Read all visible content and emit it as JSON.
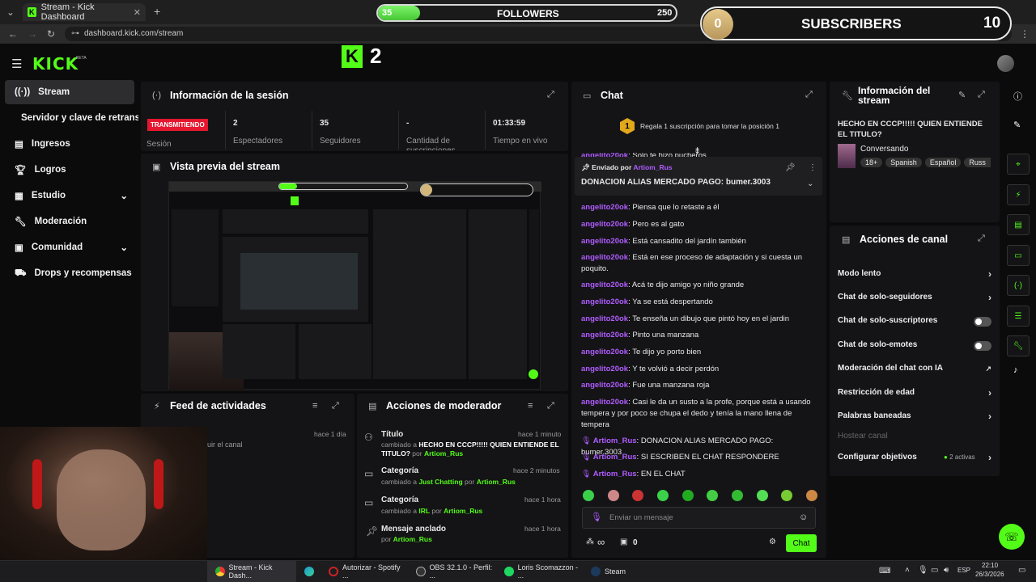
{
  "browser": {
    "tab_title": "Stream - Kick Dashboard",
    "url": "dashboard.kick.com/stream"
  },
  "overlay": {
    "followers_current": "35",
    "followers_label": "FOLLOWERS",
    "followers_goal": "250",
    "followers_progress": 0.14,
    "subscribers_current": "0",
    "subscribers_label": "SUBSCRIBERS",
    "subscribers_goal": "10",
    "kick_badge": "2"
  },
  "brand": {
    "logo": "KICK",
    "beta": "BETA",
    "accent": "#53fc18"
  },
  "sidebar": {
    "items": [
      {
        "label": "Stream",
        "icon": "broadcast-icon"
      },
      {
        "label": "Servidor y clave de retransmisión"
      },
      {
        "label": "Ingresos",
        "icon": "dollar-icon"
      },
      {
        "label": "Logros",
        "icon": "trophy-icon"
      },
      {
        "label": "Estudio",
        "icon": "studio-icon"
      },
      {
        "label": "Moderación",
        "icon": "wrench-icon"
      },
      {
        "label": "Comunidad",
        "icon": "community-icon"
      },
      {
        "label": "Drops y recompensas",
        "icon": "drops-icon"
      }
    ]
  },
  "session": {
    "title": "Información de la sesión",
    "status": "TRANSMITIENDO",
    "status_label": "Sesión",
    "stats": [
      {
        "value": "2",
        "label": "Espectadores"
      },
      {
        "value": "35",
        "label": "Seguidores"
      },
      {
        "value": "-",
        "label": "Cantidad de suscripciones"
      },
      {
        "value": "01:33:59",
        "label": "Tiempo en vivo"
      }
    ]
  },
  "preview": {
    "title": "Vista previa del stream"
  },
  "feed": {
    "title": "Feed de actividades",
    "item_time": "hace 1 día",
    "item_text": "uir el canal"
  },
  "modactions": {
    "title": "Acciones de moderador",
    "items": [
      {
        "title": "Título",
        "time": "hace 1 minuto",
        "prefix": "cambiado a",
        "value": "HECHO EN CCCP!!!!! QUIEN ENTIENDE EL TITULO?",
        "by": "por",
        "user": "Artiom_Rus"
      },
      {
        "title": "Categoría",
        "time": "hace 2 minutos",
        "prefix": "cambiado a",
        "value": "Just Chatting",
        "by": "por",
        "user": "Artiom_Rus"
      },
      {
        "title": "Categoría",
        "time": "hace 1 hora",
        "prefix": "cambiado a",
        "value": "IRL",
        "by": "por",
        "user": "Artiom_Rus"
      },
      {
        "title": "Mensaje anclado",
        "time": "hace 1 hora",
        "prefix": "",
        "value": "",
        "by": "por",
        "user": "Artiom_Rus"
      }
    ]
  },
  "chat": {
    "title": "Chat",
    "gift_rank": "1",
    "gift_text": "Regala 1 suscripción para tomar la posición 1",
    "partial_msg_user": "angelito20ok",
    "partial_msg_text": "Solo te hizo pucheros",
    "pinned_label": "Enviado por",
    "pinned_user": "Artiom_Rus",
    "pinned_text": "DONACION ALIAS MERCADO PAGO: bumer.3003",
    "messages": [
      {
        "user": "angelito20ok",
        "text": "Piensa que lo retaste a él"
      },
      {
        "user": "angelito20ok",
        "text": "Pero es al gato"
      },
      {
        "user": "angelito20ok",
        "text": "Está cansadito del jardín también"
      },
      {
        "user": "angelito20ok",
        "text": "Está en ese proceso de adaptación y si cuesta un poquito."
      },
      {
        "user": "angelito20ok",
        "text": "Acá te dijo amigo yo niño grande"
      },
      {
        "user": "angelito20ok",
        "text": "Ya se está despertando"
      },
      {
        "user": "angelito20ok",
        "text": "Te enseña un dibujo que pintó hoy en el jardin"
      },
      {
        "user": "angelito20ok",
        "text": "Pinto una manzana"
      },
      {
        "user": "angelito20ok",
        "text": "Te dijo yo porto bien"
      },
      {
        "user": "angelito20ok",
        "text": "Y te volvió a decir perdón"
      },
      {
        "user": "angelito20ok",
        "text": "Fue una manzana roja"
      },
      {
        "user": "angelito20ok",
        "text": "Casi le da un susto a la profe, porque está a usando tempera y por poco se chupa el dedo y tenía la mano llena de tempera"
      },
      {
        "user": "Artiom_Rus",
        "text": "DONACION ALIAS MERCADO PAGO: bumer.3003"
      },
      {
        "user": "Artiom_Rus",
        "text": "SI ESCRIBEN EL CHAT RESPONDERE"
      },
      {
        "user": "Artiom_Rus",
        "text": "EN EL CHAT"
      }
    ],
    "input_placeholder": "Enviar un mensaje",
    "infinity": "∞",
    "points": "0",
    "send_label": "Chat"
  },
  "streaminfo": {
    "title": "Información del stream",
    "stream_title": "HECHO EN CCCP!!!!! QUIEN ENTIENDE EL TITULO?",
    "category": "Conversando",
    "tags": [
      "18+",
      "Spanish",
      "Español",
      "Russ"
    ]
  },
  "channel_actions": {
    "title": "Acciones de canal",
    "items": [
      {
        "label": "Modo lento",
        "control": "chevron"
      },
      {
        "label": "Chat de solo-seguidores",
        "control": "chevron"
      },
      {
        "label": "Chat de solo-suscriptores",
        "control": "toggle"
      },
      {
        "label": "Chat de solo-emotes",
        "control": "toggle"
      },
      {
        "label": "Moderación del chat con IA",
        "control": "external"
      },
      {
        "label": "Restricción de edad",
        "control": "chevron"
      },
      {
        "label": "Palabras baneadas",
        "control": "chevron"
      },
      {
        "label": "Hostear canal",
        "control": "none"
      },
      {
        "label": "Configurar objetivos",
        "control": "chevron"
      }
    ],
    "objectives_badge": "2 activas"
  },
  "taskbar": {
    "apps": [
      "Stream - Kick Dash...",
      "Autorizar - Spotify ...",
      "OBS 32.1.0 - Perfil: ...",
      "Loris Scomazzon - ...",
      "Steam"
    ],
    "lang": "ESP",
    "time": "22:10",
    "date": "26/3/2026"
  }
}
